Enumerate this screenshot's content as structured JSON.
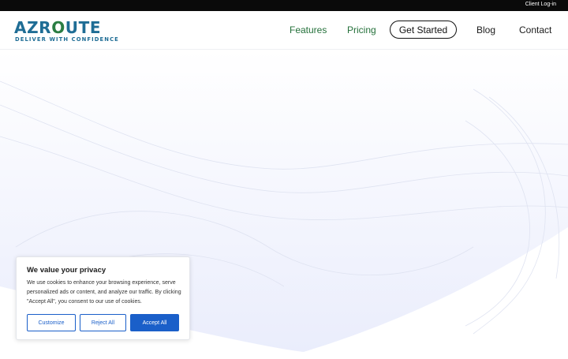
{
  "topbar": {
    "client_login": "Client Log-in"
  },
  "logo": {
    "word_blue": "AZR",
    "word_green": "O",
    "word_blue2": "UTE",
    "tagline": "DELIVER WITH CONFIDENCE"
  },
  "nav": {
    "features": "Features",
    "pricing": "Pricing",
    "get_started": "Get Started",
    "blog": "Blog",
    "contact": "Contact"
  },
  "cookie_banner": {
    "title": "We value your privacy",
    "body": "We use cookies to enhance your browsing experience, serve personalized ads or content, and analyze our traffic. By clicking \"Accept All\", you consent to our use of cookies.",
    "customize": "Customize",
    "reject_all": "Reject All",
    "accept_all": "Accept All"
  },
  "colors": {
    "brand_blue": "#1f6d95",
    "brand_green": "#2a7d43",
    "accent_blue": "#1a5fc9",
    "hero_tint": "#eef0fd"
  }
}
